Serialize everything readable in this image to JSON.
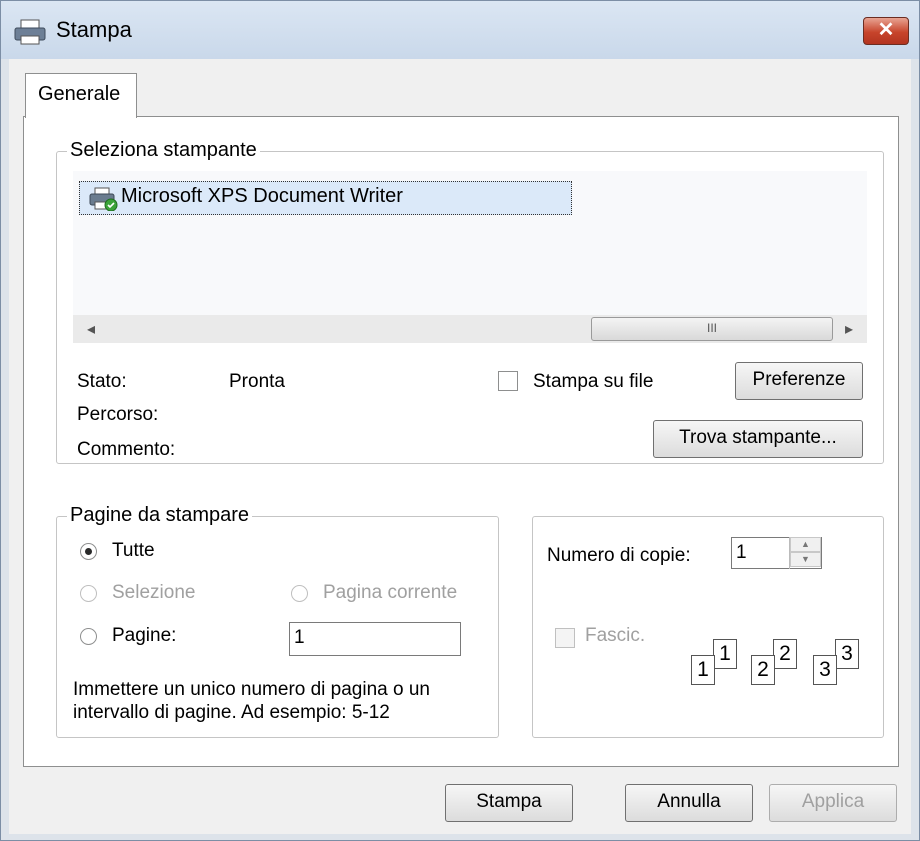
{
  "window": {
    "title": "Stampa",
    "close_label": "✕"
  },
  "tabs": [
    {
      "label": "Generale"
    }
  ],
  "printer_group": {
    "legend": "Seleziona stampante",
    "printers": [
      {
        "name": "Microsoft XPS Document Writer"
      }
    ],
    "scrollbar_grip": "III",
    "status_label": "Stato:",
    "status_value": "Pronta",
    "path_label": "Percorso:",
    "comment_label": "Commento:",
    "print_to_file": {
      "label": "Stampa su file",
      "checked": false
    },
    "preferences_button": "Preferenze",
    "find_printer_button": "Trova stampante..."
  },
  "pages_group": {
    "legend": "Pagine da stampare",
    "options": [
      {
        "label": "Tutte",
        "selected": true,
        "enabled": true
      },
      {
        "label": "Selezione",
        "selected": false,
        "enabled": false
      },
      {
        "label": "Pagina corrente",
        "selected": false,
        "enabled": false
      },
      {
        "label": "Pagine:",
        "selected": false,
        "enabled": true
      }
    ],
    "pages_value": "1",
    "hint_line1": "Immettere un unico numero di pagina o un",
    "hint_line2": "intervallo di pagine. Ad esempio: 5-12"
  },
  "copies_group": {
    "copies_label": "Numero di copie:",
    "copies_value": "1",
    "collate_label": "Fascic.",
    "collate_enabled": false,
    "collate_pages": [
      "1",
      "1",
      "2",
      "2",
      "3",
      "3"
    ]
  },
  "footer": {
    "print_button": "Stampa",
    "cancel_button": "Annulla",
    "apply_button": "Applica"
  }
}
